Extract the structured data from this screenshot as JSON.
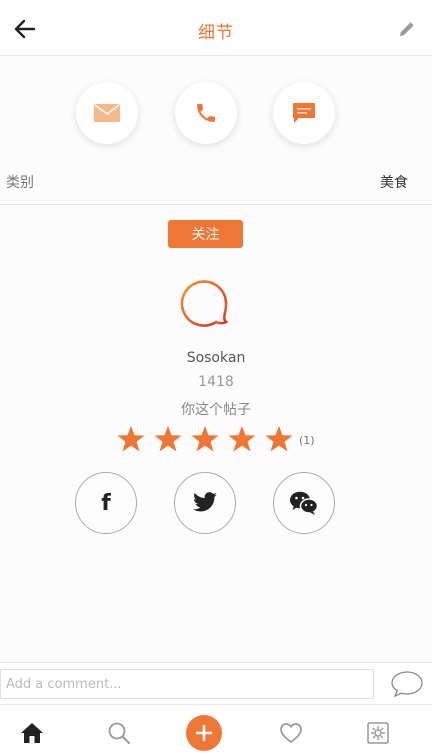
{
  "header": {
    "title": "细节",
    "back_icon": "arrow-left-icon",
    "edit_icon": "pencil-icon"
  },
  "contact": {
    "mail_icon": "mail-icon",
    "phone_icon": "phone-icon",
    "chat_icon": "chat-icon"
  },
  "category": {
    "label": "类别",
    "value": "美食"
  },
  "follow_label": "关注",
  "profile": {
    "name": "Sosokan",
    "number": "1418",
    "description": "你这个帖子"
  },
  "rating": {
    "stars": 5,
    "max": 5,
    "count_label": "(1)"
  },
  "share": {
    "facebook_label": "f",
    "twitter_icon": "twitter-icon",
    "wechat_icon": "wechat-icon"
  },
  "comment": {
    "placeholder": "Add a comment...",
    "send_icon": "speech-bubble-icon"
  },
  "tabs": [
    "home-icon",
    "search-icon",
    "add-icon",
    "heart-icon",
    "settings-icon"
  ],
  "colors": {
    "accent": "#ef7736",
    "mail_accent": "#f5b98a"
  }
}
